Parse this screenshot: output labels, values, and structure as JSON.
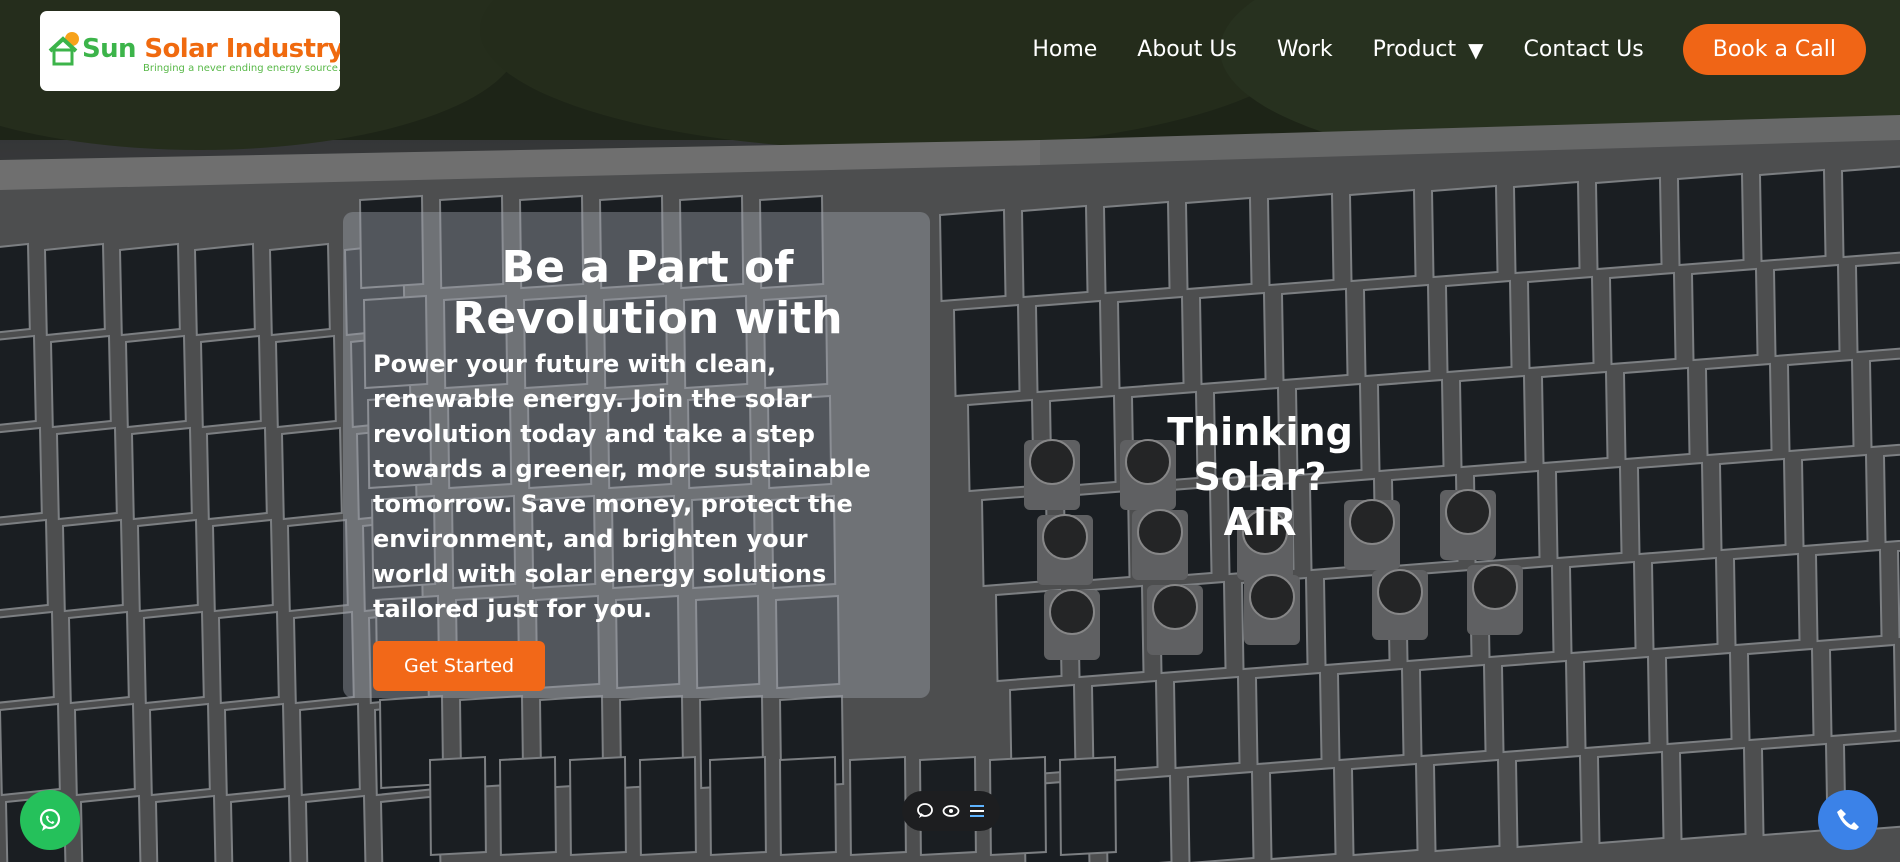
{
  "header": {
    "logo": {
      "title_part1": "Sun",
      "title_part2": "Solar Industry",
      "tagline": "Bringing a never ending energy source...."
    },
    "nav": {
      "home": "Home",
      "about": "About Us",
      "work": "Work",
      "product": "Product",
      "contact": "Contact Us",
      "product_caret": "▼"
    },
    "cta": "Book a Call"
  },
  "hero": {
    "title": "Be a Part of Revolution with",
    "text": "Power your future with clean, renewable energy. Join the solar revolution today and take a step towards a greener, more sustainable tomorrow. Save money, protect the environment, and brighten your world with solar energy solutions tailored just for you.",
    "button": "Get Started"
  },
  "side_heading": {
    "line1": "Thinking Solar?",
    "line2": "AIR"
  },
  "widgets": {
    "whatsapp_icon": "whatsapp-icon",
    "phone_icon": "phone-icon",
    "toolbar_icons": [
      "chat-icon",
      "eye-icon",
      "list-icon"
    ]
  },
  "colors": {
    "accent": "#f06516",
    "whatsapp": "#25c15b",
    "phone": "#3b82e8"
  }
}
